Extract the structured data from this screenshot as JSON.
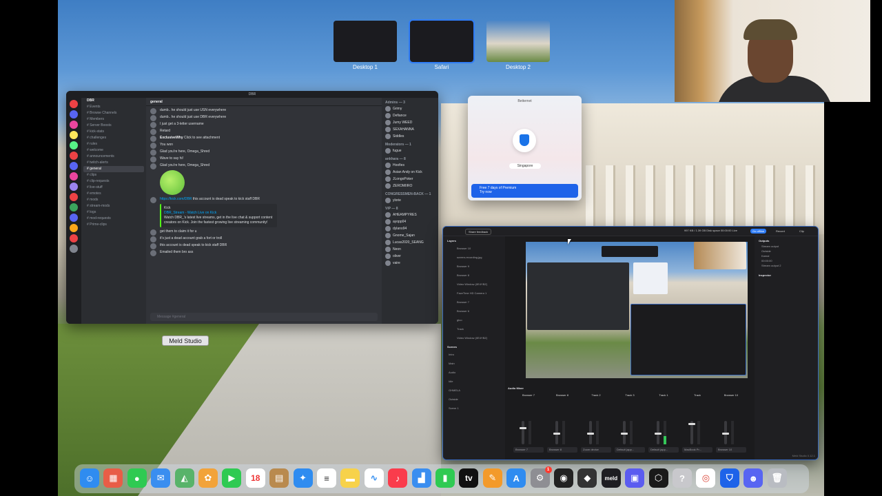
{
  "spaces": [
    {
      "label": "Desktop 1",
      "active": false
    },
    {
      "label": "Safari",
      "active": true
    },
    {
      "label": "Desktop 2",
      "active": false
    }
  ],
  "discord": {
    "window_title": "DBR",
    "server_name": "DBR",
    "channel_header": "general",
    "channels": [
      "Events",
      "Browse Channels",
      "Members",
      "Server Boosts",
      "kick-stats",
      "challenges",
      "rules",
      "welcome",
      "announcements",
      "twitch-alerts",
      "general",
      "clips",
      "clip-requests",
      "live-stuff",
      "emotes",
      "mods",
      "stream-mods",
      "logs",
      "mod-requests",
      "Prime-clips"
    ],
    "active_channel": "general",
    "messages": [
      {
        "author": "",
        "text": "dumb.. he should just use USN everywhere"
      },
      {
        "author": "",
        "text": "dumb.. he should just use DBR everywhere"
      },
      {
        "author": "",
        "text": "I just get a 3-letter username"
      },
      {
        "author": "",
        "text": "Retard"
      },
      {
        "author": "ExclusiveWhy",
        "text": "Click to see attachment"
      },
      {
        "author": "",
        "text": "You won"
      },
      {
        "author": "",
        "text": "Glad you're here, Omega_Shred"
      },
      {
        "author": "",
        "text": "Wave to say hi!"
      },
      {
        "author": "",
        "text": "Glad you're here, Omega_Shred"
      }
    ],
    "link_message": {
      "url": "https://kick.com/DBR",
      "text": "this account is dead speak to kick staff DBR"
    },
    "embed": {
      "provider": "Kick",
      "title": "DBR_Stream - Watch Live on Kick",
      "body": "Watch DBR_'s latest live streams, get in the live chat & support content creators on Kick. Join the fastest growing live streaming community!"
    },
    "tail_messages": [
      "get them to claim it for u",
      "it's just a dead account grab a fort or troll",
      "this account is dead speak to kick staff DBR",
      "Emailed them bro ass"
    ],
    "input_placeholder": "Message #general",
    "user_name": "DBR",
    "member_sections": [
      {
        "title": "Admins — 3",
        "members": [
          "Grimy",
          "Defiance",
          "Jumy WEED",
          "SEXAHANNA",
          "Siddles"
        ]
      },
      {
        "title": "Moderators — 1",
        "members": [
          "fugue"
        ]
      },
      {
        "title": "ankhara — 8",
        "members": [
          "Hoofies",
          "Asian Andy on Kick",
          "JLongoPoker",
          "ZEROMIIRO"
        ]
      },
      {
        "title": "CONGRESSMEN-BACK — 1",
        "members": [
          "ylorie"
        ]
      },
      {
        "title": "VIP — 8",
        "members": [
          "AHEAMPYRES",
          "ayopp04",
          "dylano94",
          "Gnome_Sajan",
          "Lucas2020_SEANG",
          "Neon",
          "oliver",
          "vaire"
        ]
      }
    ]
  },
  "betternet": {
    "title": "Betternet",
    "location": "Singapore",
    "premium_title": "Free 7 days of Premium",
    "premium_sub": "Try now"
  },
  "meld": {
    "feedback_button": "Share feedback",
    "stats": [
      "997 KB / 1.39 GB",
      "Disk space",
      "00:00:00",
      "Live"
    ],
    "top_buttons": [
      "Go offline",
      "Record",
      "Clip"
    ],
    "layers_title": "Layers",
    "layers": [
      "Browser 10",
      "screen-recording.jpg",
      "Browser 9",
      "Browser 8",
      "Video Window (0E4YBZ)",
      "FaceTime HD Camera 1",
      "Browser 7",
      "Browser 6",
      "gtco",
      "Track",
      "Video Window (0E4YBZ)"
    ],
    "scenes_title": "Scenes",
    "scenes": [
      "Intro",
      "Main",
      "Audio",
      "Idle",
      "GHMELA",
      "Outside",
      "Scene 1"
    ],
    "outputs_title": "Outputs",
    "outputs": [
      "Stream output",
      "Outside",
      "Kamal",
      "Stream output 2"
    ],
    "output_status": "00:00:00",
    "inspector_title": "Inspector",
    "preview_tag": "Meld Studio",
    "mixer_title": "Audio Mixer",
    "channels": [
      {
        "name": "Browser 7",
        "device": "Browser 7",
        "level": 0.7,
        "meter": 0.0
      },
      {
        "name": "Browser 8",
        "device": "Browser 8",
        "level": 0.45,
        "meter": 0.0
      },
      {
        "name": "Track 2",
        "device": "Zoom device",
        "level": 0.45,
        "meter": 0.0
      },
      {
        "name": "Track 3",
        "device": "Default (app...",
        "level": 0.45,
        "meter": 0.0
      },
      {
        "name": "Track 1",
        "device": "Default (app...",
        "level": 0.45,
        "meter": 0.35
      },
      {
        "name": "Track",
        "device": "MacBook Pr...",
        "level": 0.9,
        "meter": 0.0
      },
      {
        "name": "Browser 10",
        "device": "Browser 10",
        "level": 0.45,
        "meter": 0.0
      }
    ],
    "version": "Meld Studio 0.12.1"
  },
  "dock": [
    {
      "name": "finder-icon",
      "glyph": "☺",
      "color": "#2f8cf0"
    },
    {
      "name": "launchpad-icon",
      "glyph": "▦",
      "color": "#e85d47"
    },
    {
      "name": "messages-icon",
      "glyph": "●",
      "color": "#2fca52"
    },
    {
      "name": "mail-icon",
      "glyph": "✉",
      "color": "#3a8ef0"
    },
    {
      "name": "maps-icon",
      "glyph": "◭",
      "color": "#58b36a"
    },
    {
      "name": "photos-icon",
      "glyph": "✿",
      "color": "#f2a33a"
    },
    {
      "name": "facetime-icon",
      "glyph": "▶",
      "color": "#2fca52"
    },
    {
      "name": "calendar-icon",
      "glyph": "18",
      "color": "#ffffff",
      "text": "#e33",
      "label": "18"
    },
    {
      "name": "folder-icon",
      "glyph": "▤",
      "color": "#b98a4e"
    },
    {
      "name": "safari-icon",
      "glyph": "✦",
      "color": "#2f8cf0"
    },
    {
      "name": "reminders-icon",
      "glyph": "≡",
      "color": "#ffffff",
      "text": "#333"
    },
    {
      "name": "notes-icon",
      "glyph": "▬",
      "color": "#f7d24a"
    },
    {
      "name": "freeform-icon",
      "glyph": "∿",
      "color": "#ffffff",
      "text": "#2f8cf0"
    },
    {
      "name": "music-icon",
      "glyph": "♪",
      "color": "#fa3c4c"
    },
    {
      "name": "keynote-icon",
      "glyph": "▟",
      "color": "#3a8ef0"
    },
    {
      "name": "numbers-icon",
      "glyph": "▮",
      "color": "#2fca52"
    },
    {
      "name": "appletv-icon",
      "glyph": "tv",
      "color": "#111111",
      "label": "tv"
    },
    {
      "name": "pages-icon",
      "glyph": "✎",
      "color": "#f39a2a"
    },
    {
      "name": "appstore-icon",
      "glyph": "A",
      "color": "#2f8cf0"
    },
    {
      "name": "settings-icon",
      "glyph": "⚙",
      "color": "#8e8e93",
      "badge": "1"
    },
    {
      "name": "obs-icon",
      "glyph": "◉",
      "color": "#222222"
    },
    {
      "name": "davinci-icon",
      "glyph": "◆",
      "color": "#333333"
    },
    {
      "name": "meld-icon",
      "glyph": "meld",
      "color": "#1e1e22",
      "label": "meld"
    },
    {
      "name": "screen-icon",
      "glyph": "▣",
      "color": "#5b5cf0"
    },
    {
      "name": "cube-icon",
      "glyph": "⬡",
      "color": "#1a1a1a"
    },
    {
      "name": "help-icon",
      "glyph": "?",
      "color": "#c8c8cc"
    },
    {
      "name": "chrome-icon",
      "glyph": "◎",
      "color": "#ffffff",
      "text": "#db4437"
    },
    {
      "name": "betternet-icon",
      "glyph": "⛉",
      "color": "#1e63e9"
    },
    {
      "name": "discord-icon",
      "glyph": "☻",
      "color": "#5865f2"
    },
    {
      "name": "trash-icon",
      "glyph": "🗑",
      "color": "#b9bcc2"
    }
  ]
}
